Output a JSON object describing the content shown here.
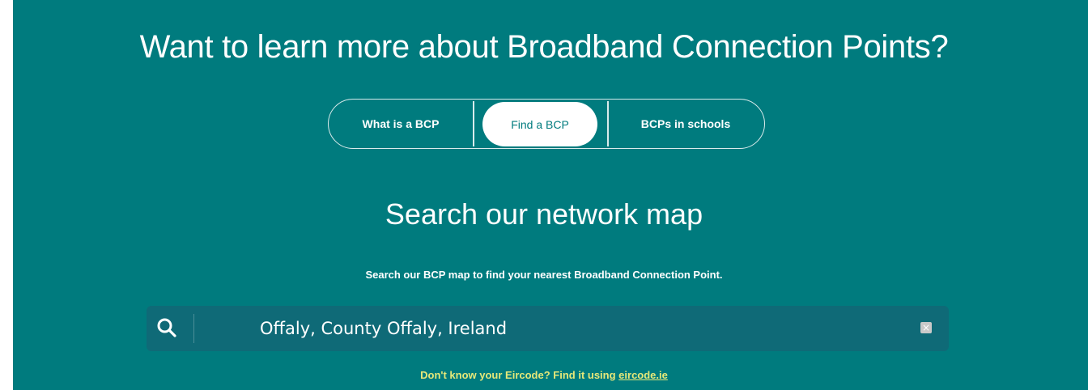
{
  "header": {
    "title": "Want to learn more about Broadband Connection Points?"
  },
  "tabs": [
    {
      "label": "What is a BCP",
      "active": false
    },
    {
      "label": "Find a BCP",
      "active": true
    },
    {
      "label": "BCPs in schools",
      "active": false
    }
  ],
  "search_section": {
    "title": "Search our network map",
    "description": "Search our BCP map to find your nearest Broadband Connection Point.",
    "input_value": "Offaly, County Offaly, Ireland",
    "clear_label": "×",
    "hint_prefix": "Don't know your Eircode? Find it using ",
    "hint_link": "eircode.ie"
  },
  "colors": {
    "background": "#007b7e",
    "search_bg": "#0f6a77",
    "hint": "#e6e879"
  }
}
